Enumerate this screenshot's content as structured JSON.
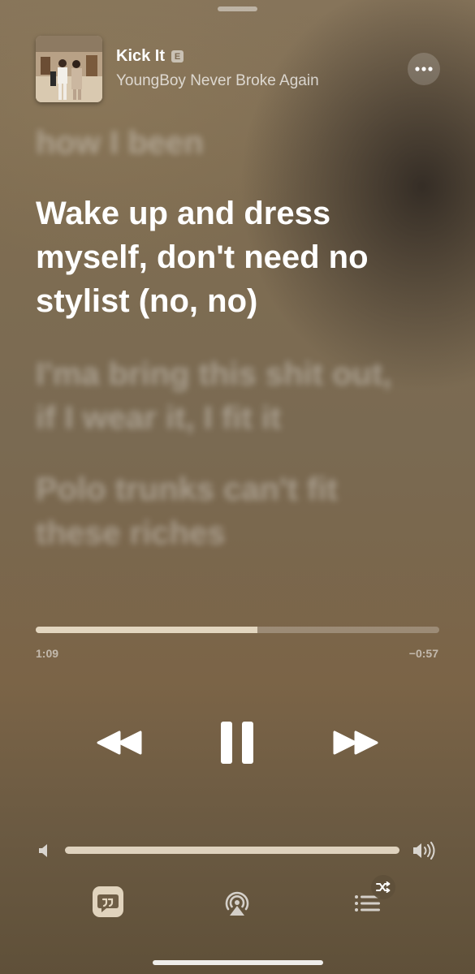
{
  "song": {
    "title": "Kick It",
    "explicit_badge": "E",
    "artist": "YoungBoy Never Broke Again"
  },
  "lyrics": {
    "previous": "how I been",
    "current": "Wake up and dress myself, don't need no stylist (no, no)",
    "next_1": "I'ma bring this shit out, if I wear it, I fit it",
    "next_2": "Polo trunks can't fit these riches"
  },
  "playback": {
    "elapsed": "1:09",
    "remaining": "−0:57",
    "progress_fraction": 0.55,
    "state": "playing"
  },
  "volume": {
    "level_fraction": 1.0
  },
  "icons": {
    "more": "more-ellipsis-icon",
    "rewind": "rewind-icon",
    "pause": "pause-icon",
    "fast_forward": "fast-forward-icon",
    "volume_low": "volume-low-icon",
    "volume_high": "volume-high-icon",
    "lyrics": "lyrics-quote-icon",
    "airplay": "airplay-icon",
    "queue": "queue-list-icon",
    "shuffle": "shuffle-icon"
  },
  "colors": {
    "background": "#7f6d52",
    "accent_track": "#ebdec8"
  }
}
